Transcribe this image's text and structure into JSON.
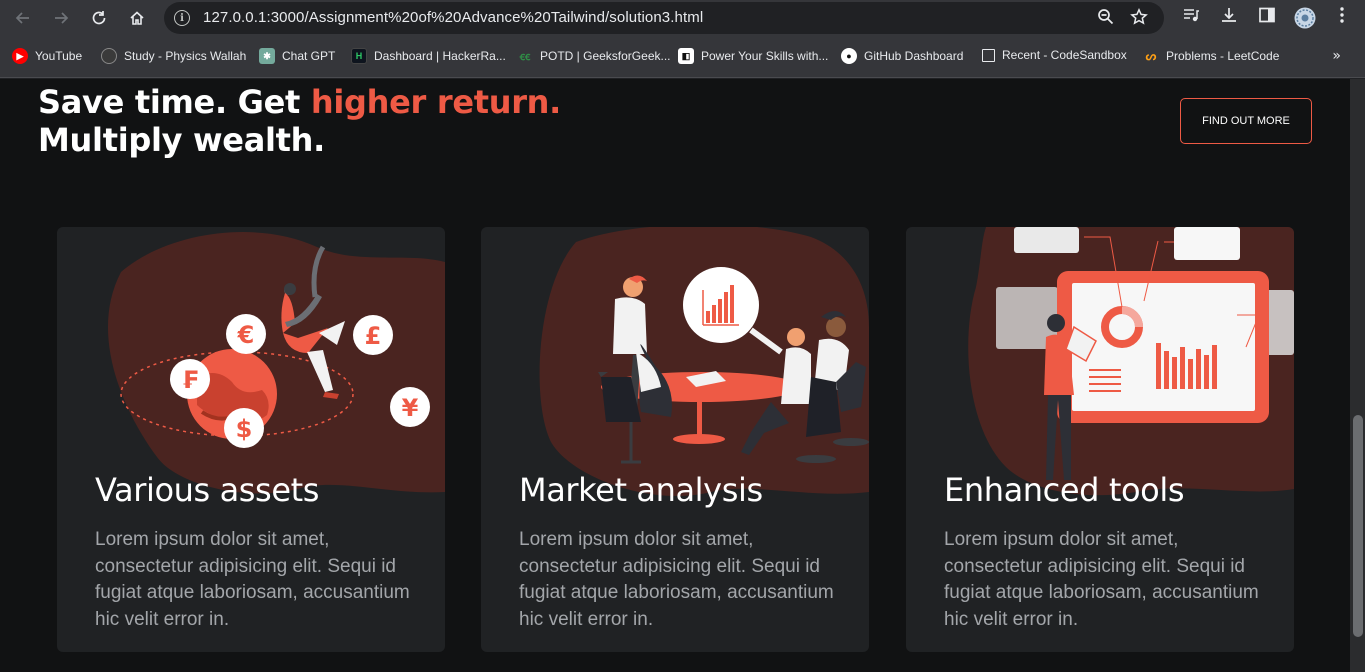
{
  "browser": {
    "url": "127.0.0.1:3000/Assignment%20of%20Advance%20Tailwind/solution3.html",
    "icons": {
      "back": "back-arrow-icon",
      "forward": "forward-arrow-icon",
      "reload": "reload-icon",
      "home": "home-icon",
      "zoom": "zoom-icon",
      "star": "star-icon",
      "media": "media-control-icon",
      "download": "download-icon",
      "sidepanel": "side-panel-icon",
      "profile": "profile-avatar",
      "menu": "kebab-menu-icon"
    },
    "bookmarks": [
      {
        "label": "YouTube",
        "icon": "youtube-icon",
        "color": "#ff0000"
      },
      {
        "label": "Study - Physics Wallah",
        "icon": "physics-wallah-icon",
        "color": "#555555"
      },
      {
        "label": "Chat GPT",
        "icon": "chatgpt-icon",
        "color": "#74aa9c"
      },
      {
        "label": "Dashboard | HackerRa...",
        "icon": "hackerrank-icon",
        "color": "#0e141e"
      },
      {
        "label": "POTD | GeeksforGeek...",
        "icon": "geeksforgeeks-icon",
        "color": "#2f8d46"
      },
      {
        "label": "Power Your Skills with...",
        "icon": "skills-icon",
        "color": "#ffffff"
      },
      {
        "label": "GitHub Dashboard",
        "icon": "github-icon",
        "color": "#ffffff"
      },
      {
        "label": "Recent - CodeSandbox",
        "icon": "codesandbox-icon",
        "color": "#ffffff"
      },
      {
        "label": "Problems - LeetCode",
        "icon": "leetcode-icon",
        "color": "#ffa116"
      }
    ],
    "more_bookmarks": "»"
  },
  "hero": {
    "line1_prefix": "Save time. Get ",
    "line1_accent": "higher return.",
    "line2": "Multiply wealth.",
    "cta": "FIND OUT MORE"
  },
  "cards": [
    {
      "title": "Various assets",
      "body": "Lorem ipsum dolor sit amet, consectetur adipisicing elit. Sequi id fugiat atque laboriosam, accusantium hic velit error in.",
      "illustration": "currency-globe-illustration"
    },
    {
      "title": "Market analysis",
      "body": "Lorem ipsum dolor sit amet, consectetur adipisicing elit. Sequi id fugiat atque laboriosam, accusantium hic velit error in.",
      "illustration": "meeting-chart-illustration"
    },
    {
      "title": "Enhanced tools",
      "body": "Lorem ipsum dolor sit amet, consectetur adipisicing elit. Sequi id fugiat atque laboriosam, accusantium hic velit error in.",
      "illustration": "dashboard-tools-illustration"
    }
  ],
  "currency_symbols": [
    "€",
    "£",
    "₣",
    "¥",
    "$"
  ],
  "colors": {
    "accent": "#ee5a45",
    "card_bg": "#202224",
    "page_bg": "#111213",
    "blob": "#4a2420"
  }
}
